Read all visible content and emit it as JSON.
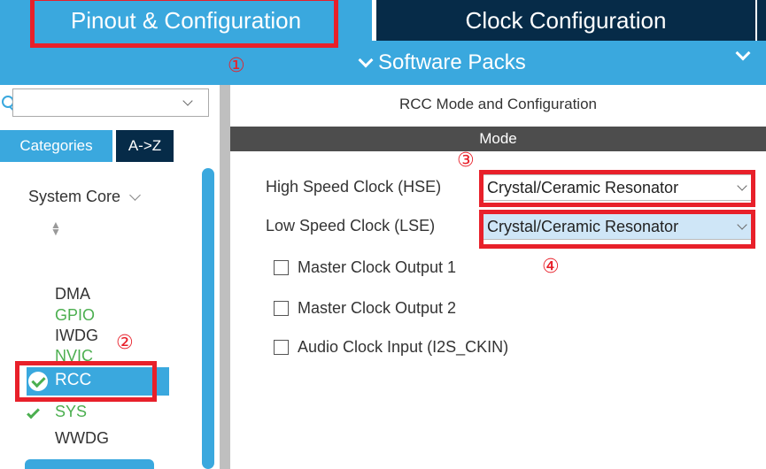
{
  "tabs": {
    "pinout": "Pinout & Configuration",
    "clock": "Clock Configuration"
  },
  "packs_bar": {
    "label": "Software Packs"
  },
  "sidebar": {
    "search_value": "",
    "categories_label": "Categories",
    "az_label": "A->Z",
    "group_label": "System Core",
    "items": [
      {
        "label": "DMA",
        "status": "none"
      },
      {
        "label": "GPIO",
        "status": "configured"
      },
      {
        "label": "IWDG",
        "status": "none"
      },
      {
        "label": "NVIC",
        "status": "configured"
      },
      {
        "label": "RCC",
        "status": "selected-ok"
      },
      {
        "label": "SYS",
        "status": "ok"
      },
      {
        "label": "WWDG",
        "status": "none"
      }
    ]
  },
  "panel": {
    "title": "RCC Mode and Configuration",
    "mode_header": "Mode",
    "hse_label": "High Speed Clock (HSE)",
    "hse_value": "Crystal/Ceramic Resonator",
    "lse_label": "Low Speed Clock (LSE)",
    "lse_value": "Crystal/Ceramic Resonator",
    "checkboxes": [
      {
        "label": "Master Clock Output 1",
        "checked": false
      },
      {
        "label": "Master Clock Output 2",
        "checked": false
      },
      {
        "label": "Audio Clock Input (I2S_CKIN)",
        "checked": false
      }
    ]
  },
  "annotations": {
    "marker1": "①",
    "marker2": "②",
    "marker3": "③",
    "marker4": "④"
  },
  "colors": {
    "accent": "#3aa8de",
    "dark": "#062b48",
    "mode_bar": "#4d4d4d",
    "annotation_red": "#e8202a",
    "ok_green": "#4caf50"
  }
}
